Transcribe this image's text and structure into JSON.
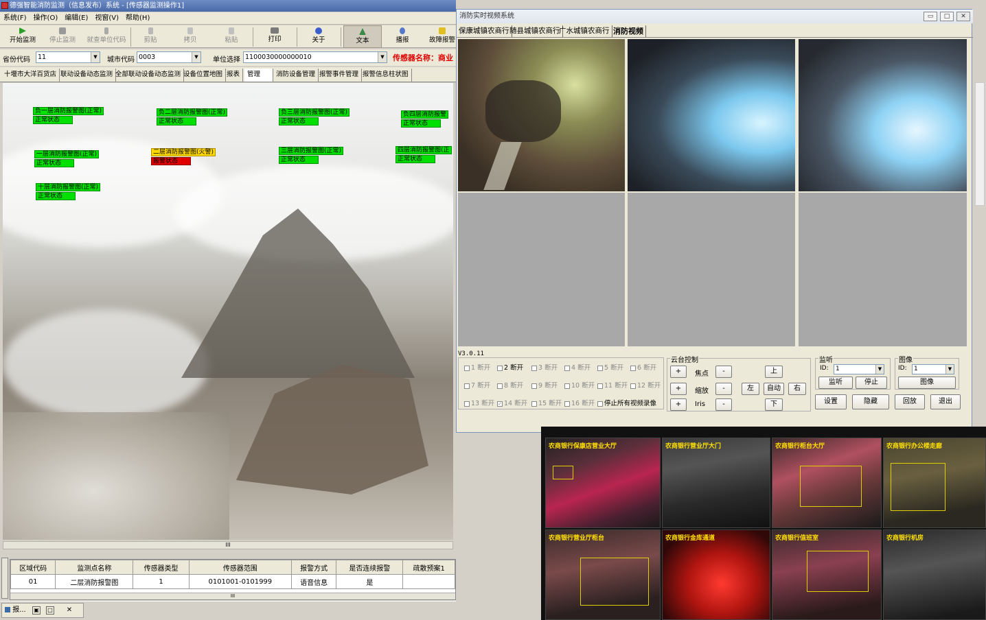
{
  "main_window": {
    "title": "德强智能消防监测（信息发布）系统 - [传感器监测操作1]",
    "menu": [
      "系统(F)",
      "操作(O)",
      "编辑(E)",
      "视窗(V)",
      "帮助(H)"
    ],
    "toolbar": [
      {
        "label": "开始监测",
        "enabled": true,
        "icon": "play-icon"
      },
      {
        "label": "停止监测",
        "enabled": false,
        "icon": "stop-icon"
      },
      {
        "label": "就查单位代码",
        "enabled": false,
        "icon": "query-icon"
      },
      {
        "label": "剪贴",
        "enabled": false,
        "icon": "cut-icon"
      },
      {
        "label": "拷贝",
        "enabled": false,
        "icon": "copy-icon"
      },
      {
        "label": "粘贴",
        "enabled": false,
        "icon": "paste-icon"
      },
      {
        "label": "打印",
        "enabled": true,
        "icon": "print-icon"
      },
      {
        "label": "关于",
        "enabled": true,
        "icon": "about-icon"
      },
      {
        "label": "文本",
        "enabled": true,
        "icon": "text-icon",
        "selected": true
      },
      {
        "label": "播报",
        "enabled": true,
        "icon": "broadcast-icon"
      },
      {
        "label": "故障报警",
        "enabled": true,
        "icon": "fault-alarm-icon"
      }
    ],
    "filters": {
      "province_label": "省份代码",
      "province_value": "11",
      "city_label": "城市代码",
      "city_value": "0003",
      "unit_label": "单位选择",
      "unit_value": "1100030000000010",
      "sensor_name_label": "传感器名称：商业"
    },
    "tabs": [
      "十堰市大洋百货店",
      "联动设备动态监测",
      "全部联动设备动态监测",
      "设备位置地图",
      "报表",
      "管理",
      "消防设备管理",
      "报警事件管理",
      "报警信息柱状图"
    ],
    "active_tab": "管理",
    "alarms": [
      {
        "name": "负一层消防报警图(正常)",
        "status": "正常状态",
        "state": "normal"
      },
      {
        "name": "负二层消防报警图(正常)",
        "status": "正常状态",
        "state": "normal"
      },
      {
        "name": "负三层消防报警图(正常)",
        "status": "正常状态",
        "state": "normal"
      },
      {
        "name": "负四层消防报警",
        "status": "正常状态",
        "state": "normal"
      },
      {
        "name": "一层消防报警图(正常)",
        "status": "正常状态",
        "state": "normal"
      },
      {
        "name": "二层消防报警图(火警)",
        "status": "报警状态",
        "state": "fire"
      },
      {
        "name": "三层消防报警图(正常)",
        "status": "正常状态",
        "state": "normal"
      },
      {
        "name": "四层消防报警图(正",
        "status": "正常状态",
        "state": "normal"
      },
      {
        "name": "十层消防报警图(正常)",
        "status": "正常状态",
        "state": "normal"
      }
    ],
    "scroll_mark": "III",
    "grid": {
      "headers": [
        "区域代码",
        "监测点名称",
        "传感器类型",
        "传感器范围",
        "报警方式",
        "是否连续报警",
        "疏散预案1"
      ],
      "rows": [
        [
          "01",
          "二层消防报警图",
          "1",
          "0101001-0101999",
          "语音信息",
          "是",
          ""
        ]
      ]
    },
    "taskbar_item": "报..."
  },
  "video_window": {
    "title": "消防实时视频系统",
    "tabs": [
      "保康城镇农商行",
      "随县城镇农商行",
      "广水城镇农商行",
      "消防视频"
    ],
    "active_tab": "消防视频",
    "version": "V3.0.11",
    "channels": [
      {
        "num": "1",
        "label": "断开",
        "checked": false,
        "enabled": false
      },
      {
        "num": "2",
        "label": "断开",
        "checked": false,
        "enabled": true
      },
      {
        "num": "3",
        "label": "断开",
        "checked": false,
        "enabled": false
      },
      {
        "num": "4",
        "label": "断开",
        "checked": false,
        "enabled": false
      },
      {
        "num": "5",
        "label": "断开",
        "checked": false,
        "enabled": false
      },
      {
        "num": "6",
        "label": "断开",
        "checked": false,
        "enabled": false
      },
      {
        "num": "7",
        "label": "断开",
        "checked": false,
        "enabled": false
      },
      {
        "num": "8",
        "label": "断开",
        "checked": false,
        "enabled": false
      },
      {
        "num": "9",
        "label": "断开",
        "checked": false,
        "enabled": false
      },
      {
        "num": "10",
        "label": "断开",
        "checked": false,
        "enabled": false
      },
      {
        "num": "11",
        "label": "断开",
        "checked": false,
        "enabled": false
      },
      {
        "num": "12",
        "label": "断开",
        "checked": false,
        "enabled": false
      },
      {
        "num": "13",
        "label": "断开",
        "checked": false,
        "enabled": false
      },
      {
        "num": "14",
        "label": "断开",
        "checked": true,
        "enabled": false
      },
      {
        "num": "15",
        "label": "断开",
        "checked": false,
        "enabled": false
      },
      {
        "num": "16",
        "label": "断开",
        "checked": false,
        "enabled": false
      }
    ],
    "stop_all_recording": "停止所有视频录像",
    "ptz": {
      "caption": "云台控制",
      "plus": "+",
      "minus": "-",
      "focus": "焦点",
      "zoom": "缩放",
      "iris": "Iris",
      "up": "上",
      "down": "下",
      "left": "左",
      "right": "右",
      "auto": "自动"
    },
    "monitor": {
      "caption": "监听",
      "id_label": "ID:",
      "id_value": "1",
      "listen": "监听",
      "stop": "停止"
    },
    "image": {
      "caption": "图像",
      "id_label": "ID:",
      "id_value": "1",
      "button": "图像"
    },
    "buttons": {
      "settings": "设置",
      "hide": "隐藏",
      "playback": "回放",
      "exit": "退出"
    },
    "window_controls": {
      "min": "▭",
      "max": "□",
      "close": "✕"
    }
  },
  "cctv_wall": {
    "captions": [
      "农商银行保康店营业大厅",
      "农商银行营业厅大门",
      "农商银行柜台大厅",
      "农商银行办公楼走廊",
      "农商银行营业厅柜台",
      "农商银行金库通道",
      "农商银行值班室",
      "农商银行机房"
    ]
  },
  "colors": {
    "normal_status": "#00e000",
    "fire_name": "#ffd800",
    "fire_status": "#e00000",
    "sensor_title": "#e00000"
  }
}
